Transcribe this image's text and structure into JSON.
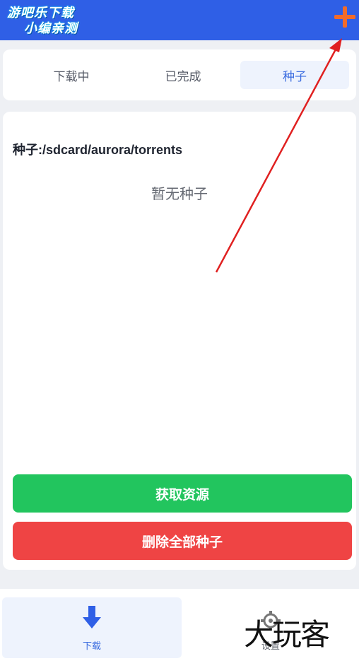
{
  "header": {
    "logo_line1": "游吧乐下载",
    "logo_line2": "小编亲测",
    "add_icon": "plus-icon",
    "add_icon_color": "#f26b2a",
    "bar_color": "#2f5fe6"
  },
  "tabs": [
    {
      "label": "下载中",
      "active": false
    },
    {
      "label": "已完成",
      "active": false
    },
    {
      "label": "种子",
      "active": true
    }
  ],
  "main": {
    "path_label": "种子:/sdcard/aurora/torrents",
    "empty_text": "暂无种子",
    "get_button": "获取资源",
    "delete_all_button": "删除全部种子",
    "get_button_color": "#22c55e",
    "delete_button_color": "#ef4444"
  },
  "bottom_nav": {
    "download_label": "下载",
    "download_icon": "arrow-down-icon",
    "settings_label": "设置",
    "settings_icon": "gear-icon"
  },
  "watermark": "大玩客",
  "annotation": {
    "arrow_color": "#e02020"
  }
}
